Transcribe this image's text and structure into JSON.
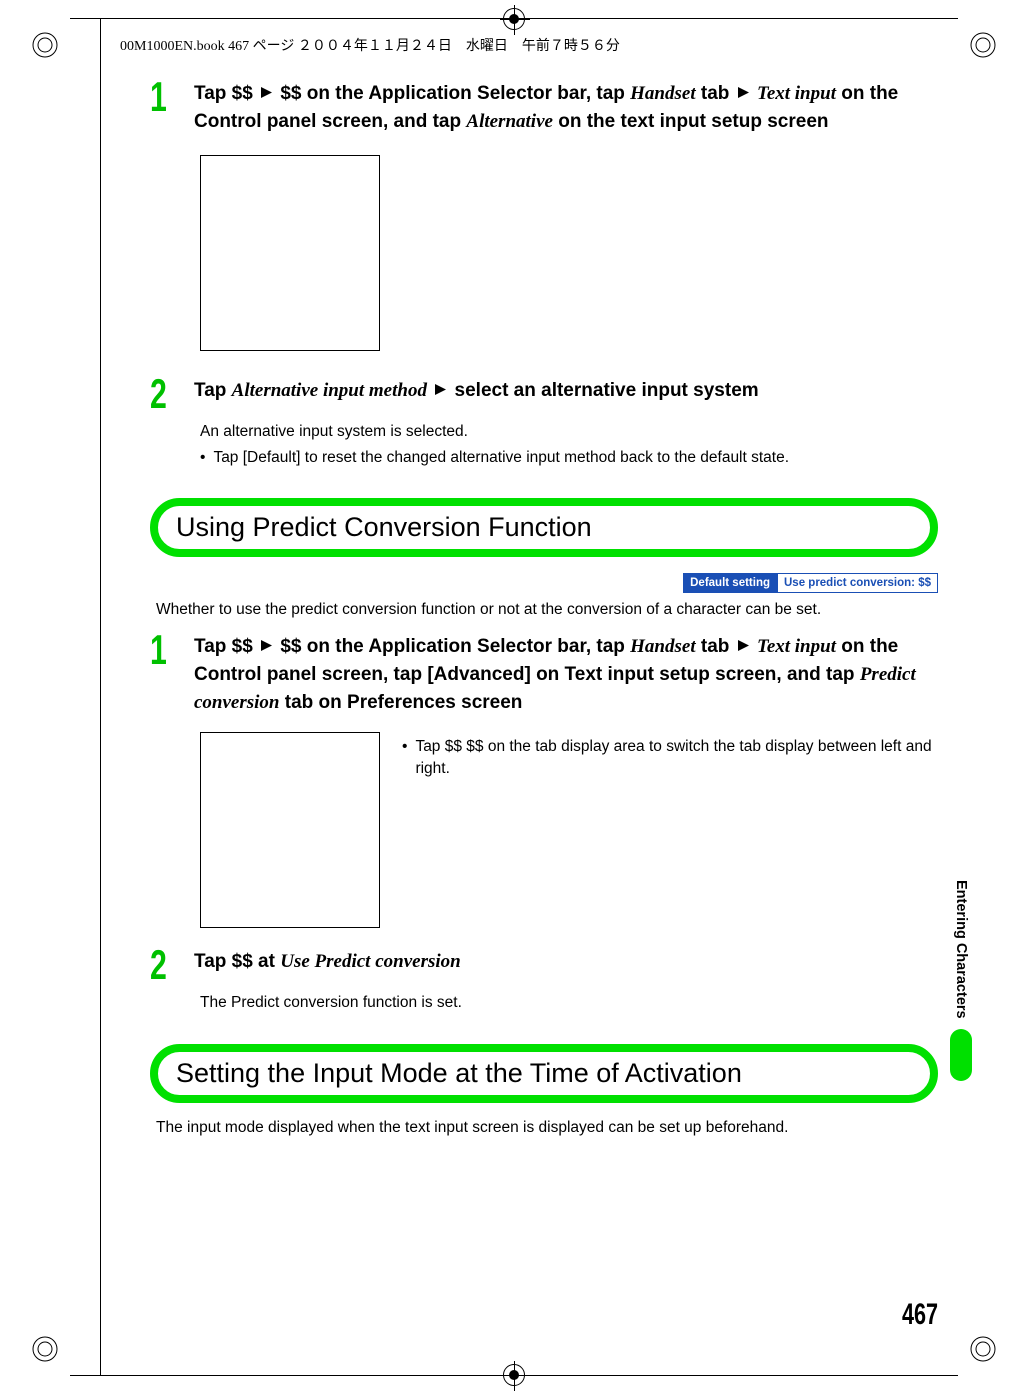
{
  "header": {
    "doc_info": "00M1000EN.book  467 ページ  ２００４年１１月２４日　水曜日　午前７時５６分"
  },
  "section1": {
    "step1_num": "1",
    "step1_parts": {
      "a": "Tap $$ ",
      "b": " $$ on the Application Selector bar, tap ",
      "handset": "Handset",
      "c": " tab ",
      "textinput": "Text input",
      "d": " on the Control panel screen, and tap ",
      "alternative": "Alternative",
      "e": " on the text input setup screen"
    },
    "step2_num": "2",
    "step2_parts": {
      "a": "Tap ",
      "alt_method": "Alternative input method",
      "b": " select an alternative input system"
    },
    "step2_sub": "An alternative input system is selected.",
    "step2_bullet": "Tap [Default] to reset the changed alternative input method back to the default state."
  },
  "heading1": "Using Predict Conversion Function",
  "badge": {
    "label": "Default setting",
    "value": "Use predict conversion: $$"
  },
  "intro1": "Whether to use the predict conversion function or not at the conversion of a character can be set.",
  "section2": {
    "step1_num": "1",
    "step1_parts": {
      "a": "Tap $$ ",
      "b": " $$ on the Application Selector bar, tap ",
      "handset": "Handset",
      "c": " tab ",
      "textinput": "Text input",
      "d": " on the Control panel screen, tap [Advanced] on Text input setup screen, and tap ",
      "predict": "Predict conversion",
      "e": " tab on Preferences screen"
    },
    "side_bullet": "Tap $$ $$ on the tab display area to switch the tab display between left and right.",
    "step2_num": "2",
    "step2_parts": {
      "a": "Tap $$ at ",
      "use_predict": "Use Predict conversion"
    },
    "step2_sub": "The Predict conversion function is set."
  },
  "heading2": "Setting the Input Mode at the Time of Activation",
  "intro2": "The input mode displayed when the text input screen is displayed can be set up beforehand.",
  "side_label": "Entering Characters",
  "page_number": "467"
}
